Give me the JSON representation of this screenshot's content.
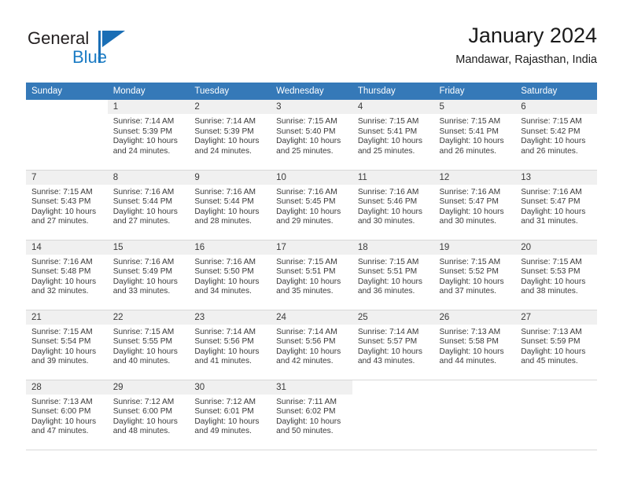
{
  "brand": {
    "name_part1": "General",
    "name_part2": "Blue",
    "triangle_color": "#1a6eb5",
    "blue_color": "#1a7bc4"
  },
  "header": {
    "title": "January 2024",
    "subtitle": "Mandawar, Rajasthan, India"
  },
  "theme": {
    "header_row_bg": "#3579b8",
    "day_number_bg": "#f0f0f0",
    "text_color": "#3a3a3a"
  },
  "weekday_headers": [
    "Sunday",
    "Monday",
    "Tuesday",
    "Wednesday",
    "Thursday",
    "Friday",
    "Saturday"
  ],
  "weeks": [
    [
      {
        "day": "",
        "sunrise": "",
        "sunset": "",
        "daylight1": "",
        "daylight2": "",
        "empty": true
      },
      {
        "day": "1",
        "sunrise": "Sunrise: 7:14 AM",
        "sunset": "Sunset: 5:39 PM",
        "daylight1": "Daylight: 10 hours",
        "daylight2": "and 24 minutes."
      },
      {
        "day": "2",
        "sunrise": "Sunrise: 7:14 AM",
        "sunset": "Sunset: 5:39 PM",
        "daylight1": "Daylight: 10 hours",
        "daylight2": "and 24 minutes."
      },
      {
        "day": "3",
        "sunrise": "Sunrise: 7:15 AM",
        "sunset": "Sunset: 5:40 PM",
        "daylight1": "Daylight: 10 hours",
        "daylight2": "and 25 minutes."
      },
      {
        "day": "4",
        "sunrise": "Sunrise: 7:15 AM",
        "sunset": "Sunset: 5:41 PM",
        "daylight1": "Daylight: 10 hours",
        "daylight2": "and 25 minutes."
      },
      {
        "day": "5",
        "sunrise": "Sunrise: 7:15 AM",
        "sunset": "Sunset: 5:41 PM",
        "daylight1": "Daylight: 10 hours",
        "daylight2": "and 26 minutes."
      },
      {
        "day": "6",
        "sunrise": "Sunrise: 7:15 AM",
        "sunset": "Sunset: 5:42 PM",
        "daylight1": "Daylight: 10 hours",
        "daylight2": "and 26 minutes."
      }
    ],
    [
      {
        "day": "7",
        "sunrise": "Sunrise: 7:15 AM",
        "sunset": "Sunset: 5:43 PM",
        "daylight1": "Daylight: 10 hours",
        "daylight2": "and 27 minutes."
      },
      {
        "day": "8",
        "sunrise": "Sunrise: 7:16 AM",
        "sunset": "Sunset: 5:44 PM",
        "daylight1": "Daylight: 10 hours",
        "daylight2": "and 27 minutes."
      },
      {
        "day": "9",
        "sunrise": "Sunrise: 7:16 AM",
        "sunset": "Sunset: 5:44 PM",
        "daylight1": "Daylight: 10 hours",
        "daylight2": "and 28 minutes."
      },
      {
        "day": "10",
        "sunrise": "Sunrise: 7:16 AM",
        "sunset": "Sunset: 5:45 PM",
        "daylight1": "Daylight: 10 hours",
        "daylight2": "and 29 minutes."
      },
      {
        "day": "11",
        "sunrise": "Sunrise: 7:16 AM",
        "sunset": "Sunset: 5:46 PM",
        "daylight1": "Daylight: 10 hours",
        "daylight2": "and 30 minutes."
      },
      {
        "day": "12",
        "sunrise": "Sunrise: 7:16 AM",
        "sunset": "Sunset: 5:47 PM",
        "daylight1": "Daylight: 10 hours",
        "daylight2": "and 30 minutes."
      },
      {
        "day": "13",
        "sunrise": "Sunrise: 7:16 AM",
        "sunset": "Sunset: 5:47 PM",
        "daylight1": "Daylight: 10 hours",
        "daylight2": "and 31 minutes."
      }
    ],
    [
      {
        "day": "14",
        "sunrise": "Sunrise: 7:16 AM",
        "sunset": "Sunset: 5:48 PM",
        "daylight1": "Daylight: 10 hours",
        "daylight2": "and 32 minutes."
      },
      {
        "day": "15",
        "sunrise": "Sunrise: 7:16 AM",
        "sunset": "Sunset: 5:49 PM",
        "daylight1": "Daylight: 10 hours",
        "daylight2": "and 33 minutes."
      },
      {
        "day": "16",
        "sunrise": "Sunrise: 7:16 AM",
        "sunset": "Sunset: 5:50 PM",
        "daylight1": "Daylight: 10 hours",
        "daylight2": "and 34 minutes."
      },
      {
        "day": "17",
        "sunrise": "Sunrise: 7:15 AM",
        "sunset": "Sunset: 5:51 PM",
        "daylight1": "Daylight: 10 hours",
        "daylight2": "and 35 minutes."
      },
      {
        "day": "18",
        "sunrise": "Sunrise: 7:15 AM",
        "sunset": "Sunset: 5:51 PM",
        "daylight1": "Daylight: 10 hours",
        "daylight2": "and 36 minutes."
      },
      {
        "day": "19",
        "sunrise": "Sunrise: 7:15 AM",
        "sunset": "Sunset: 5:52 PM",
        "daylight1": "Daylight: 10 hours",
        "daylight2": "and 37 minutes."
      },
      {
        "day": "20",
        "sunrise": "Sunrise: 7:15 AM",
        "sunset": "Sunset: 5:53 PM",
        "daylight1": "Daylight: 10 hours",
        "daylight2": "and 38 minutes."
      }
    ],
    [
      {
        "day": "21",
        "sunrise": "Sunrise: 7:15 AM",
        "sunset": "Sunset: 5:54 PM",
        "daylight1": "Daylight: 10 hours",
        "daylight2": "and 39 minutes."
      },
      {
        "day": "22",
        "sunrise": "Sunrise: 7:15 AM",
        "sunset": "Sunset: 5:55 PM",
        "daylight1": "Daylight: 10 hours",
        "daylight2": "and 40 minutes."
      },
      {
        "day": "23",
        "sunrise": "Sunrise: 7:14 AM",
        "sunset": "Sunset: 5:56 PM",
        "daylight1": "Daylight: 10 hours",
        "daylight2": "and 41 minutes."
      },
      {
        "day": "24",
        "sunrise": "Sunrise: 7:14 AM",
        "sunset": "Sunset: 5:56 PM",
        "daylight1": "Daylight: 10 hours",
        "daylight2": "and 42 minutes."
      },
      {
        "day": "25",
        "sunrise": "Sunrise: 7:14 AM",
        "sunset": "Sunset: 5:57 PM",
        "daylight1": "Daylight: 10 hours",
        "daylight2": "and 43 minutes."
      },
      {
        "day": "26",
        "sunrise": "Sunrise: 7:13 AM",
        "sunset": "Sunset: 5:58 PM",
        "daylight1": "Daylight: 10 hours",
        "daylight2": "and 44 minutes."
      },
      {
        "day": "27",
        "sunrise": "Sunrise: 7:13 AM",
        "sunset": "Sunset: 5:59 PM",
        "daylight1": "Daylight: 10 hours",
        "daylight2": "and 45 minutes."
      }
    ],
    [
      {
        "day": "28",
        "sunrise": "Sunrise: 7:13 AM",
        "sunset": "Sunset: 6:00 PM",
        "daylight1": "Daylight: 10 hours",
        "daylight2": "and 47 minutes."
      },
      {
        "day": "29",
        "sunrise": "Sunrise: 7:12 AM",
        "sunset": "Sunset: 6:00 PM",
        "daylight1": "Daylight: 10 hours",
        "daylight2": "and 48 minutes."
      },
      {
        "day": "30",
        "sunrise": "Sunrise: 7:12 AM",
        "sunset": "Sunset: 6:01 PM",
        "daylight1": "Daylight: 10 hours",
        "daylight2": "and 49 minutes."
      },
      {
        "day": "31",
        "sunrise": "Sunrise: 7:11 AM",
        "sunset": "Sunset: 6:02 PM",
        "daylight1": "Daylight: 10 hours",
        "daylight2": "and 50 minutes."
      },
      {
        "day": "",
        "sunrise": "",
        "sunset": "",
        "daylight1": "",
        "daylight2": "",
        "empty": true
      },
      {
        "day": "",
        "sunrise": "",
        "sunset": "",
        "daylight1": "",
        "daylight2": "",
        "empty": true
      },
      {
        "day": "",
        "sunrise": "",
        "sunset": "",
        "daylight1": "",
        "daylight2": "",
        "empty": true
      }
    ]
  ]
}
